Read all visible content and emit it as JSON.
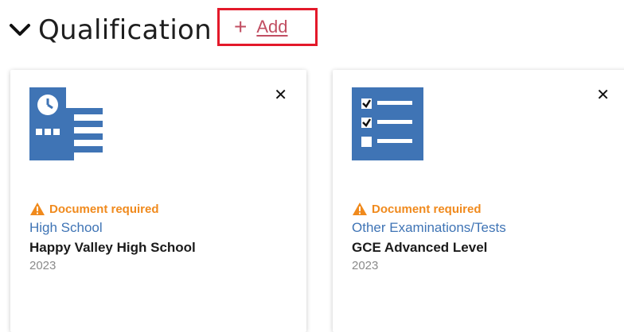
{
  "section": {
    "title": "Qualification",
    "add_label": "Add",
    "add_symbol": "+"
  },
  "cards": [
    {
      "icon": "school-building-icon",
      "warning": "Document required",
      "category": "High School",
      "name": "Happy Valley High School",
      "year": "2023",
      "close": "✕"
    },
    {
      "icon": "checklist-icon",
      "warning": "Document required",
      "category": "Other Examinations/Tests",
      "name": "GCE Advanced Level",
      "year": "2023",
      "close": "✕"
    }
  ],
  "colors": {
    "accent": "#e3192a",
    "add_text": "#c14e62",
    "warning": "#f08a1d",
    "link": "#3f74b5",
    "icon_blue": "#3f74b5"
  }
}
